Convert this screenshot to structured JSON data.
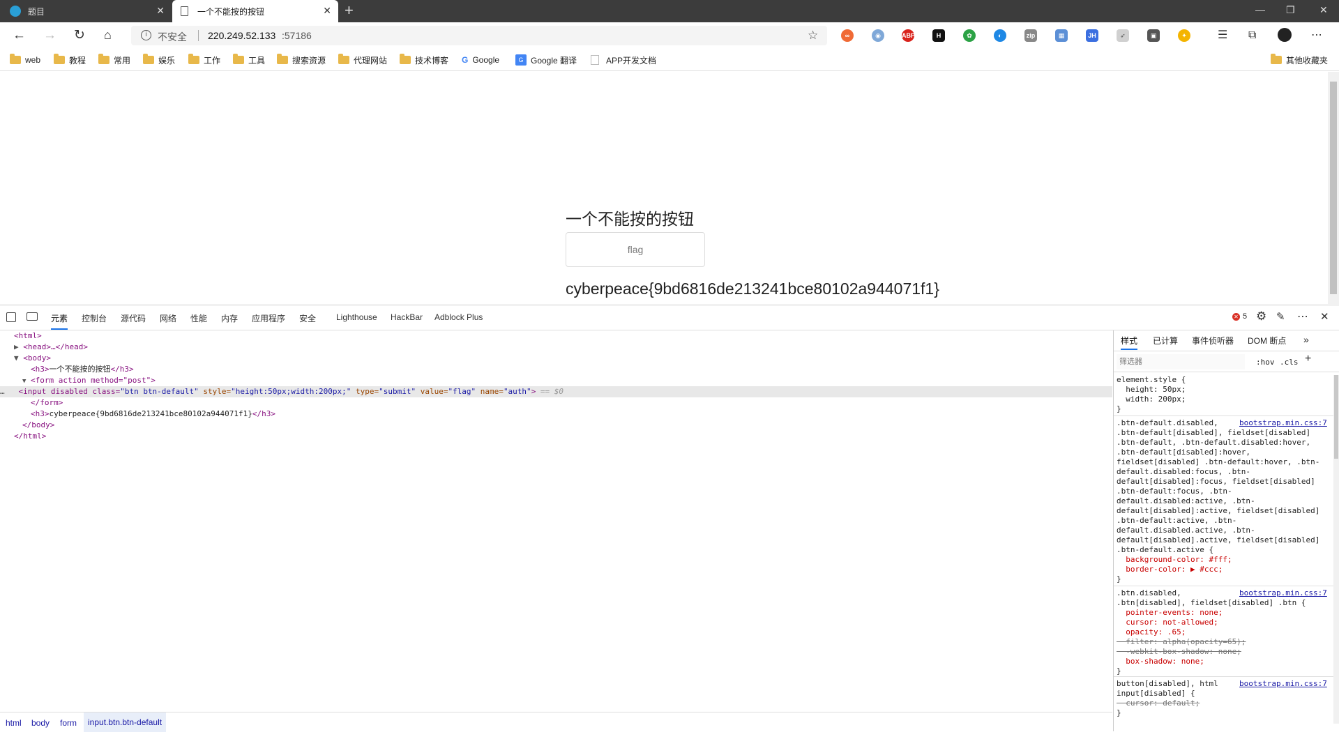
{
  "tabs": [
    {
      "title": "题目",
      "active": false
    },
    {
      "title": "一个不能按的按钮",
      "active": true
    }
  ],
  "address": {
    "security_label": "不安全",
    "url_host": "220.249.52.133",
    "url_port": ":57186"
  },
  "bookmarks": [
    {
      "label": "web",
      "icon": "folder-icon"
    },
    {
      "label": "教程",
      "icon": "folder-icon"
    },
    {
      "label": "常用",
      "icon": "folder-icon"
    },
    {
      "label": "娱乐",
      "icon": "folder-icon"
    },
    {
      "label": "工作",
      "icon": "folder-icon"
    },
    {
      "label": "工具",
      "icon": "folder-icon"
    },
    {
      "label": "搜索资源",
      "icon": "folder-icon"
    },
    {
      "label": "代理网站",
      "icon": "folder-icon"
    },
    {
      "label": "技术博客",
      "icon": "folder-icon"
    },
    {
      "label": "Google",
      "icon": "google-icon"
    },
    {
      "label": "Google 翻译",
      "icon": "translate-icon"
    },
    {
      "label": "APP开发文档",
      "icon": "page-icon"
    }
  ],
  "bookmarks_other": "其他收藏夹",
  "page": {
    "heading": "一个不能按的按钮",
    "button_value": "flag",
    "flag_text": "cyberpeace{9bd6816de213241bce80102a944071f1}"
  },
  "devtools": {
    "tabs": [
      "元素",
      "控制台",
      "源代码",
      "网络",
      "性能",
      "内存",
      "应用程序",
      "安全",
      "Lighthouse",
      "HackBar",
      "Adblock Plus"
    ],
    "error_count": "5",
    "dom": {
      "html_open": "<html>",
      "head": "<head>…</head>",
      "body_open": "<body>",
      "h3_open": "<h3>",
      "h3_text": "一个不能按的按钮",
      "h3_close": "</h3>",
      "form_open": "<form action method=\"post\">",
      "input_tag": "<input disabled class=",
      "input_class": "\"btn btn-default\"",
      "input_style_attr": " style=",
      "input_style": "\"height:50px;width:200px;\"",
      "input_type_attr": " type=",
      "input_type": "\"submit\"",
      "input_value_attr": " value=",
      "input_value": "\"flag\"",
      "input_name_attr": " name=",
      "input_name": "\"auth\"",
      "input_end": ">",
      "selected_marker": " == $0",
      "form_close": "</form>",
      "h3b_text": "cyberpeace{9bd6816de213241bce80102a944071f1}",
      "body_close": "</body>",
      "html_close": "</html>"
    },
    "styles_tabs": [
      "样式",
      "已计算",
      "事件侦听器",
      "DOM 断点"
    ],
    "filter_placeholder": "筛选器",
    "hov": ":hov",
    "cls": ".cls",
    "rules": [
      {
        "lines": [
          "element.style {",
          "  height: 50px;",
          "  width: 200px;",
          "}"
        ]
      },
      {
        "source": "bootstrap.min.css:7",
        "lines": [
          ".btn-default.disabled,",
          ".btn-default[disabled], fieldset[disabled]",
          ".btn-default, .btn-default.disabled:hover,",
          ".btn-default[disabled]:hover,",
          "fieldset[disabled] .btn-default:hover, .btn-",
          "default.disabled:focus, .btn-",
          "default[disabled]:focus, fieldset[disabled]",
          ".btn-default:focus, .btn-",
          "default.disabled:active, .btn-",
          "default[disabled]:active, fieldset[disabled]",
          ".btn-default:active, .btn-",
          "default.disabled.active, .btn-",
          "default[disabled].active, fieldset[disabled]",
          ".btn-default.active {",
          "  background-color: #fff;",
          "  border-color: ▶ #ccc;",
          "}"
        ]
      },
      {
        "source": "bootstrap.min.css:7",
        "lines": [
          ".btn.disabled,",
          ".btn[disabled], fieldset[disabled] .btn {",
          "  pointer-events: none;",
          "  cursor: not-allowed;",
          "  opacity: .65;",
          "  filter: alpha(opacity=65);",
          "  -webkit-box-shadow: none;",
          "  box-shadow: none;",
          "}"
        ]
      },
      {
        "source": "bootstrap.min.css:7",
        "lines": [
          "button[disabled], html",
          "input[disabled] {",
          "  cursor: default;",
          "}"
        ]
      }
    ],
    "breadcrumbs": [
      "html",
      "body",
      "form",
      "input.btn.btn-default"
    ]
  },
  "colors": {
    "tabstrip": "#3c3c3c",
    "devtools_accent": "#1a73e8",
    "tag": "#881280",
    "attr_name": "#994500",
    "attr_value": "#1a1aa6"
  }
}
